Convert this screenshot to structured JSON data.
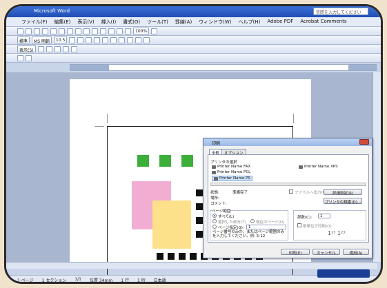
{
  "window": {
    "title": "Microsoft Word",
    "help_placeholder": "質問を入力してください"
  },
  "menu": [
    "ファイル(F)",
    "編集(E)",
    "表示(V)",
    "挿入(I)",
    "書式(O)",
    "ツール(T)",
    "罫線(A)",
    "ウィンドウ(W)",
    "ヘルプ(H)",
    "Adobe PDF",
    "Acrobat Comments"
  ],
  "toolbar": {
    "zoom": "100%",
    "style": "標準",
    "font": "MS 明朝",
    "size": "10.5",
    "view_label": "表示(S)"
  },
  "document": {
    "green_squares": 4,
    "black_squares_bottom": 10
  },
  "dialog": {
    "title": "印刷",
    "tabs": [
      "全般",
      "オプション"
    ],
    "printer_section": "プリンタの選択",
    "printers": [
      {
        "name": "Printer Name FAX",
        "selected": false
      },
      {
        "name": "Printer Name XPS",
        "selected": false
      },
      {
        "name": "Printer Name PCL",
        "selected": false
      },
      {
        "name": "Printer Name PS",
        "selected": true
      }
    ],
    "status_label": "状態:",
    "status_value": "準備完了",
    "location_label": "場所:",
    "comment_label": "コメント:",
    "print_to_file_label": "ファイルへ出力(F)",
    "preferences_button": "詳細設定(R)",
    "find_printer_button": "プリンタの検索(D)...",
    "page_range_label": "ページ範囲",
    "all_label": "すべて(L)",
    "selection_label": "選択した部分(T)",
    "current_page_label": "現在のページ(U)",
    "pages_label": "ページ指定(G):",
    "pages_value": "1",
    "pages_hint": "ページ番号のみか、またはページ範囲のみを入力してください。例: 5-12",
    "copies_label": "部数(C):",
    "copies_value": "1",
    "collate_label": "部単位で印刷(O)",
    "print_button": "印刷(P)",
    "cancel_button": "キャンセル",
    "apply_button": "適用(A)"
  },
  "status": {
    "page": "1 ページ",
    "section": "1 セクション",
    "page_of": "1/1",
    "position": "位置 34mm",
    "line": "1 行",
    "column": "1 桁",
    "lang": "日本語"
  }
}
